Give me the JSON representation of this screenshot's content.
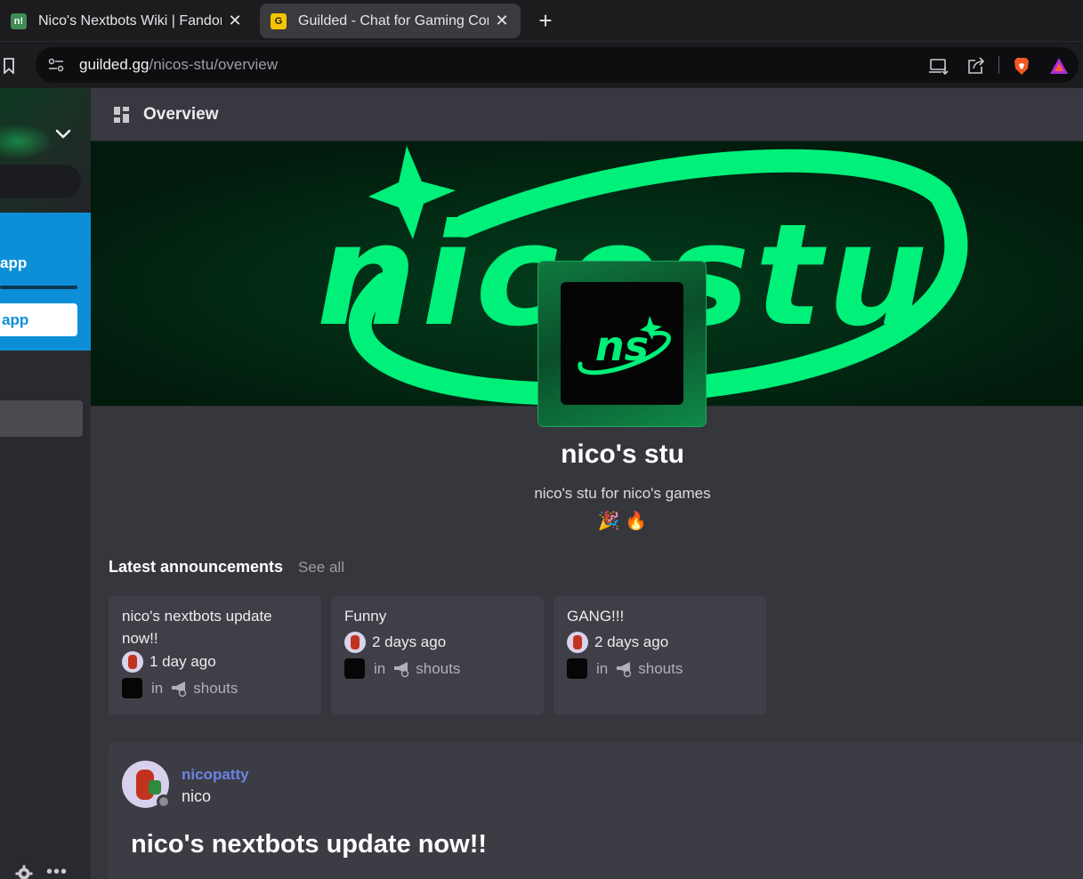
{
  "browser": {
    "tabs": [
      {
        "title": "Nico's Nextbots Wiki | Fandom",
        "favicon": "fandom-favicon",
        "active": false
      },
      {
        "title": "Guilded - Chat for Gaming Comm",
        "favicon": "guilded-favicon",
        "active": true
      }
    ],
    "favicon_letters": {
      "fandom": "n!",
      "guilded": "G"
    },
    "close_glyph": "✕",
    "new_tab_glyph": "+",
    "url_host": "guilded.gg",
    "url_path": "/nicos-stu/overview",
    "toolbar_icons": [
      "bookmark-icon",
      "site-settings-icon",
      "install-app-icon",
      "share-icon",
      "brave-shield-icon",
      "brave-rewards-icon"
    ]
  },
  "sidebar": {
    "promo_text": "app",
    "promo_button": "app",
    "more_glyph": "•••",
    "bottom_icons": [
      "gear-icon",
      "more-icon"
    ]
  },
  "header": {
    "title": "Overview",
    "icon": "overview-grid-icon"
  },
  "server": {
    "name": "nico's stu",
    "description": "nico's stu for nico's games",
    "emojis": "🎉 🔥",
    "banner_text": "nicostu",
    "logo_text": "ns"
  },
  "announcements": {
    "heading": "Latest announcements",
    "see_all": "See all",
    "in_label": "in",
    "items": [
      {
        "title": "nico's nextbots update now!!",
        "time": "1 day ago",
        "channel": "shouts"
      },
      {
        "title": "Funny",
        "time": "2 days ago",
        "channel": "shouts"
      },
      {
        "title": "GANG!!!",
        "time": "2 days ago",
        "channel": "shouts"
      }
    ]
  },
  "post": {
    "username": "nicopatty",
    "display_name": "nico",
    "title": "nico's nextbots update now!!"
  },
  "colors": {
    "accent_green": "#00f07a",
    "link_purple": "#6c82e6",
    "promo_blue": "#0d8fd8"
  }
}
